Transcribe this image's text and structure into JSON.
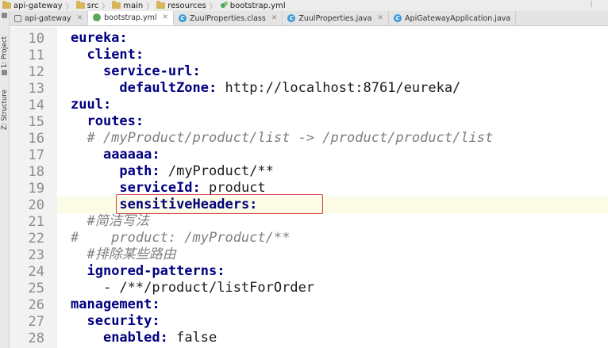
{
  "breadcrumb": [
    {
      "label": "api-gateway",
      "icon": "folder-icon"
    },
    {
      "label": "src",
      "icon": "folder-icon"
    },
    {
      "label": "main",
      "icon": "folder-icon"
    },
    {
      "label": "resources",
      "icon": "folder-icon"
    },
    {
      "label": "bootstrap.yml",
      "icon": "yml-file-icon"
    }
  ],
  "tabs": [
    {
      "label": "api-gateway",
      "icon": "module-icon",
      "active": false
    },
    {
      "label": "bootstrap.yml",
      "icon": "yml-file-icon",
      "active": true
    },
    {
      "label": "ZuulProperties.class",
      "icon": "class-icon",
      "active": false
    },
    {
      "label": "ZuulProperties.java",
      "icon": "class-icon",
      "active": false
    },
    {
      "label": "ApiGatewayApplication.java",
      "icon": "class-icon",
      "active": false
    }
  ],
  "toolwindows": {
    "project_label": "1: Project",
    "structure_label": "Z: Structure"
  },
  "editor": {
    "lines": [
      {
        "n": "10",
        "parts": [
          {
            "t": "eureka:",
            "k": true
          }
        ]
      },
      {
        "n": "11",
        "parts": [
          {
            "t": "  "
          },
          {
            "t": "client:",
            "k": true
          }
        ]
      },
      {
        "n": "12",
        "parts": [
          {
            "t": "    "
          },
          {
            "t": "service-url:",
            "k": true
          }
        ]
      },
      {
        "n": "13",
        "parts": [
          {
            "t": "      "
          },
          {
            "t": "defaultZone:",
            "k": true
          },
          {
            "t": " http://localhost:8761/eureka/"
          }
        ]
      },
      {
        "n": "14",
        "parts": [
          {
            "t": "zuul:",
            "k": true
          }
        ]
      },
      {
        "n": "15",
        "parts": [
          {
            "t": "  "
          },
          {
            "t": "routes:",
            "k": true
          }
        ]
      },
      {
        "n": "16",
        "parts": [
          {
            "t": "  "
          },
          {
            "t": "# /myProduct/product/list -> /product/product/list",
            "c": true
          }
        ]
      },
      {
        "n": "17",
        "parts": [
          {
            "t": "    "
          },
          {
            "t": "aaaaaa:",
            "k": true
          }
        ]
      },
      {
        "n": "18",
        "parts": [
          {
            "t": "      "
          },
          {
            "t": "path:",
            "k": true
          },
          {
            "t": " /myProduct/**"
          }
        ]
      },
      {
        "n": "19",
        "parts": [
          {
            "t": "      "
          },
          {
            "t": "serviceId:",
            "k": true
          },
          {
            "t": " product"
          }
        ]
      },
      {
        "n": "20",
        "parts": [
          {
            "t": "      "
          },
          {
            "t": "sensitiveHeaders:",
            "k": true
          }
        ]
      },
      {
        "n": "21",
        "parts": [
          {
            "t": "  "
          },
          {
            "t": "#简洁写法",
            "c": true
          }
        ]
      },
      {
        "n": "22",
        "parts": [
          {
            "t": "#    product: /myProduct/**",
            "c": true
          }
        ]
      },
      {
        "n": "23",
        "parts": [
          {
            "t": "  "
          },
          {
            "t": "#排除某些路由",
            "c": true
          }
        ]
      },
      {
        "n": "24",
        "parts": [
          {
            "t": "  "
          },
          {
            "t": "ignored-patterns:",
            "k": true
          }
        ]
      },
      {
        "n": "25",
        "parts": [
          {
            "t": "    - /**/product/listForOrder"
          }
        ]
      },
      {
        "n": "26",
        "parts": [
          {
            "t": "management:",
            "k": true
          }
        ]
      },
      {
        "n": "27",
        "parts": [
          {
            "t": "  "
          },
          {
            "t": "security:",
            "k": true
          }
        ]
      },
      {
        "n": "28",
        "parts": [
          {
            "t": "    "
          },
          {
            "t": "enabled:",
            "k": true
          },
          {
            "t": " false"
          }
        ]
      }
    ],
    "current_line": "20"
  },
  "colors": {
    "key": "#000080",
    "comment": "#7f7f7f",
    "highlight_border": "#d43d3d"
  }
}
